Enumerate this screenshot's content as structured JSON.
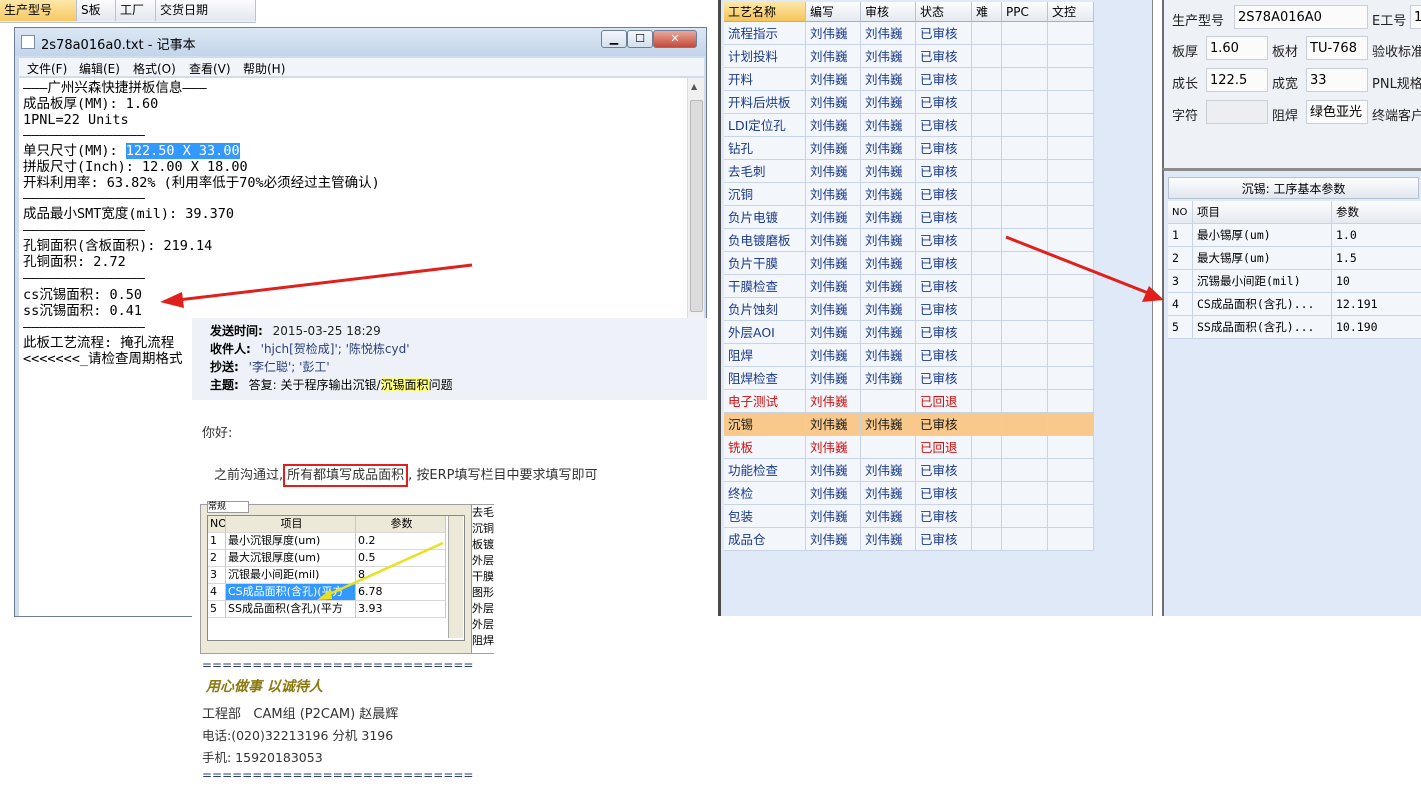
{
  "top_strip": {
    "cols": [
      "生产型号",
      "S板",
      "工厂",
      "交货日期"
    ]
  },
  "notepad": {
    "title": "2s78a016a0.txt - 记事本",
    "menu": [
      "文件(F)",
      "编辑(E)",
      "格式(O)",
      "查看(V)",
      "帮助(H)"
    ],
    "lines": [
      "———广州兴森快捷拼板信息———",
      "成品板厚(MM): 1.60",
      "1PNL=22 Units",
      "———————————————",
      "单只尺寸(MM): ",
      "拼版尺寸(Inch): 12.00 X 18.00",
      "开料利用率: 63.82% (利用率低于70%必须经过主管确认)",
      "———————————————",
      "成品最小SMT宽度(mil): 39.370",
      "———————————————",
      "孔铜面积(含板面积): 219.14",
      "孔铜面积: 2.72",
      "———————————————",
      "cs沉锡面积: 0.50",
      "ss沉锡面积: 0.41",
      "———————————————",
      "此板工艺流程: 掩孔流程",
      "<<<<<<<_请检查周期格式"
    ],
    "selected_text": "122.50 X 33.00"
  },
  "email": {
    "sent_label": "发送时间:",
    "sent_value": "2015-03-25 18:29",
    "to_label": "收件人:",
    "to_value": "'hjch[贺检成]'; '陈悦栋cyd'",
    "cc_label": "抄送:",
    "cc_value": "'李仁聪'; '彭工'",
    "subject_label": "主题:",
    "subject_value_pre": "答复: 关于程序输出沉银/",
    "subject_value_hl": "沉锡面积",
    "subject_value_post": "问题",
    "greeting": "你好:",
    "body_pre": "之前沟通过,",
    "body_box": "所有都填写成品面积",
    "body_post": ", 按ERP填写栏目中要求填写即可",
    "embedded": {
      "tab": "常规",
      "headers": [
        "NO",
        "项目",
        "参数"
      ],
      "rows": [
        [
          "1",
          "最小沉银厚度(um)",
          "0.2"
        ],
        [
          "2",
          "最大沉银厚度(um)",
          "0.5"
        ],
        [
          "3",
          "沉银最小间距(mil)",
          "8"
        ],
        [
          "4",
          "CS成品面积(含孔)(平方",
          "6.78"
        ],
        [
          "5",
          "SS成品面积(含孔)(平方",
          "3.93"
        ]
      ],
      "side_items": [
        "去毛",
        "沉铜",
        "板镀",
        "外层",
        "干膜",
        "图形",
        "外层",
        "外层",
        "阻焊"
      ]
    },
    "divider": "===========================",
    "motto": "用心做事 以诚待人",
    "dept": "工程部   CAM组 (P2CAM) 赵晨辉",
    "phone": "电话:(020)32213196 分机 3196",
    "mobile": "手机: 15920183053"
  },
  "process_table": {
    "headers": [
      "工艺名称",
      "编写",
      "审核",
      "状态",
      "难",
      "PPC",
      "文控"
    ],
    "rows": [
      [
        "流程指示",
        "刘伟巍",
        "刘伟巍",
        "已审核"
      ],
      [
        "计划投料",
        "刘伟巍",
        "刘伟巍",
        "已审核"
      ],
      [
        "开料",
        "刘伟巍",
        "刘伟巍",
        "已审核"
      ],
      [
        "开料后烘板",
        "刘伟巍",
        "刘伟巍",
        "已审核"
      ],
      [
        "LDI定位孔",
        "刘伟巍",
        "刘伟巍",
        "已审核"
      ],
      [
        "钻孔",
        "刘伟巍",
        "刘伟巍",
        "已审核"
      ],
      [
        "去毛刺",
        "刘伟巍",
        "刘伟巍",
        "已审核"
      ],
      [
        "沉铜",
        "刘伟巍",
        "刘伟巍",
        "已审核"
      ],
      [
        "负片电镀",
        "刘伟巍",
        "刘伟巍",
        "已审核"
      ],
      [
        "负电镀磨板",
        "刘伟巍",
        "刘伟巍",
        "已审核"
      ],
      [
        "负片干膜",
        "刘伟巍",
        "刘伟巍",
        "已审核"
      ],
      [
        "干膜检查",
        "刘伟巍",
        "刘伟巍",
        "已审核"
      ],
      [
        "负片蚀刻",
        "刘伟巍",
        "刘伟巍",
        "已审核"
      ],
      [
        "外层AOI",
        "刘伟巍",
        "刘伟巍",
        "已审核"
      ],
      [
        "阻焊",
        "刘伟巍",
        "刘伟巍",
        "已审核"
      ],
      [
        "阻焊检查",
        "刘伟巍",
        "刘伟巍",
        "已审核"
      ],
      [
        "电子测试",
        "刘伟巍",
        "",
        "已回退"
      ],
      [
        "沉锡",
        "刘伟巍",
        "刘伟巍",
        "已审核"
      ],
      [
        "铣板",
        "刘伟巍",
        "",
        "已回退"
      ],
      [
        "功能检查",
        "刘伟巍",
        "刘伟巍",
        "已审核"
      ],
      [
        "终检",
        "刘伟巍",
        "刘伟巍",
        "已审核"
      ],
      [
        "包装",
        "刘伟巍",
        "刘伟巍",
        "已审核"
      ],
      [
        "成品仓",
        "刘伟巍",
        "刘伟巍",
        "已审核"
      ]
    ],
    "selected_row": 17,
    "returned_rows": [
      16,
      18
    ]
  },
  "right_form": {
    "labels": [
      "生产型号",
      "E工号",
      "板厚",
      "板材",
      "验收标准",
      "成长",
      "成宽",
      "PNL规格",
      "字符",
      "阻焊",
      "终端客户"
    ],
    "model_value": "2S78A016A0",
    "eno_value": "1",
    "thickness_value": "1.60",
    "material_value": "TU-768",
    "length_value": "122.5",
    "width_value": "33",
    "char_value": "",
    "mask_value": "绿色亚光"
  },
  "param_panel": {
    "title": "沉锡: 工序基本参数",
    "headers": [
      "NO",
      "项目",
      "参数"
    ],
    "rows": [
      [
        "1",
        "最小锡厚(um)",
        "1.0"
      ],
      [
        "2",
        "最大锡厚(um)",
        "1.5"
      ],
      [
        "3",
        "沉锡最小间距(mil)",
        "10"
      ],
      [
        "4",
        "CS成品面积(含孔)...",
        "12.191"
      ],
      [
        "5",
        "SS成品面积(含孔)...",
        "10.190"
      ]
    ]
  },
  "colors": {
    "arrow_red": "#e0201c",
    "arrow_yellow": "#e8e020",
    "row_highlight": "#f8c98a",
    "status_returned": "#d01010"
  }
}
